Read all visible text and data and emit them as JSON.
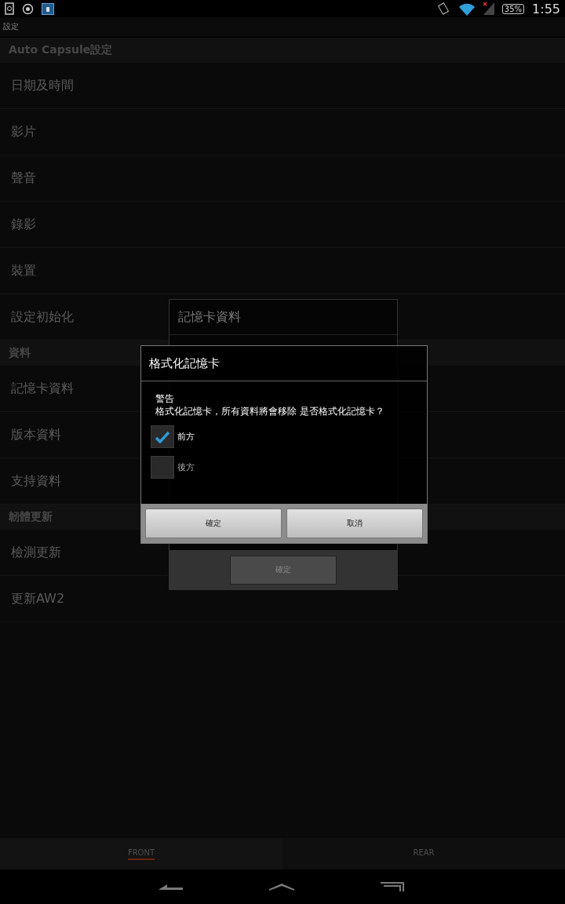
{
  "status_bar": {
    "battery": "35%",
    "time": "1:55"
  },
  "app_bar": {
    "title": "設定"
  },
  "sections": [
    {
      "header": "Auto Capsule設定",
      "items": [
        "日期及時間",
        "影片",
        "聲音",
        "錄影",
        "裝置",
        "設定初始化"
      ]
    },
    {
      "header": "資料",
      "items": [
        "記憶卡資料",
        "版本資料",
        "支持資料"
      ]
    },
    {
      "header": "韌體更新",
      "items": [
        "檢測更新",
        "更新AW2"
      ]
    }
  ],
  "info_dialog": {
    "title": "記憶卡資料",
    "button": "確定"
  },
  "format_dialog": {
    "title": "格式化記憶卡",
    "warning": "警告",
    "message": "格式化記憶卡，所有資料將會移除 是否格式化記憶卡？",
    "options": [
      {
        "label": "前方",
        "checked": true
      },
      {
        "label": "後方",
        "checked": false
      }
    ],
    "buttons": [
      "確定",
      "取消"
    ]
  },
  "tabs": [
    {
      "label": "FRONT",
      "selected": true
    },
    {
      "label": "REAR",
      "selected": false
    }
  ]
}
